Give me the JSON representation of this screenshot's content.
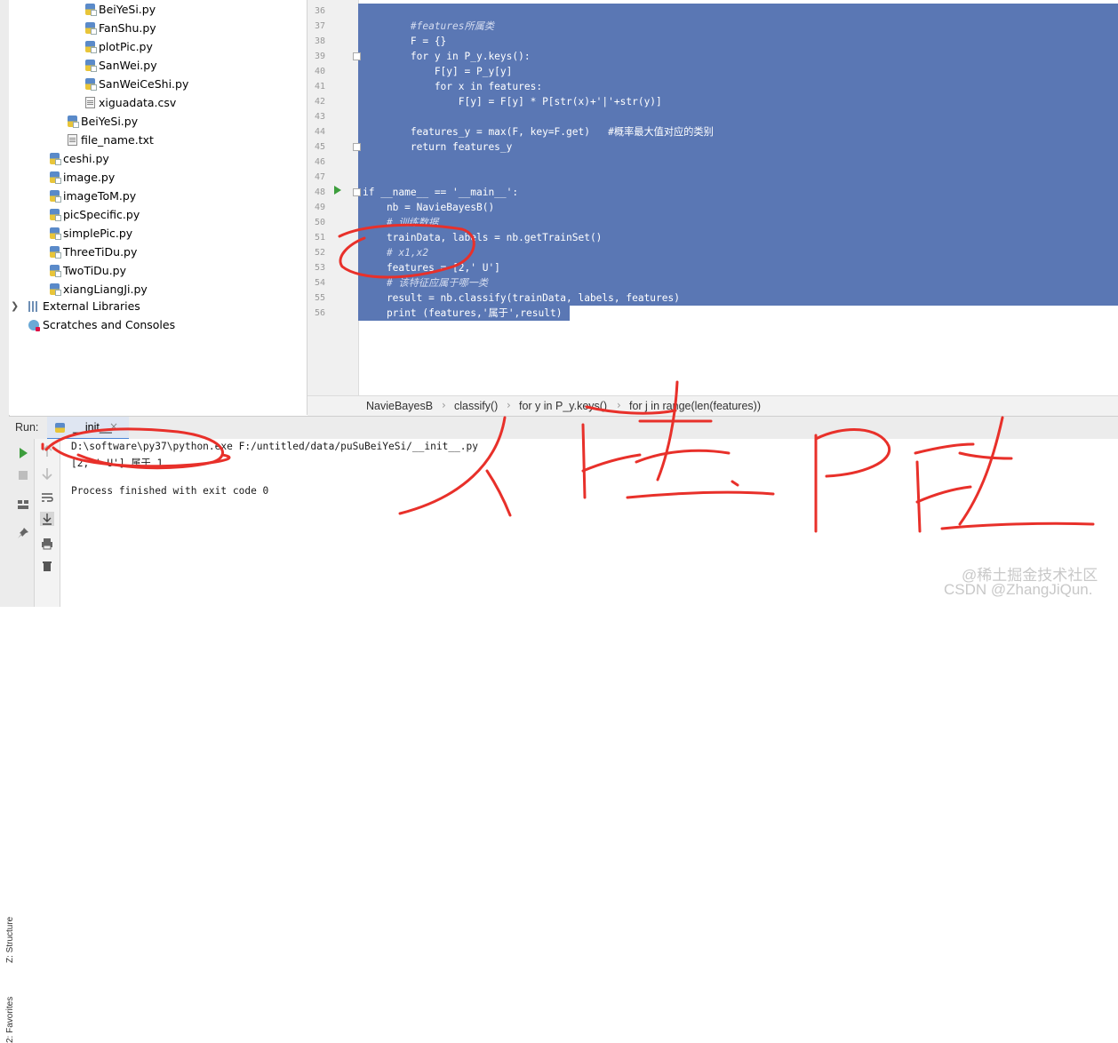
{
  "project_tree": {
    "items": [
      {
        "label": "BeiYeSi.py",
        "type": "py"
      },
      {
        "label": "FanShu.py",
        "type": "py"
      },
      {
        "label": "plotPic.py",
        "type": "py"
      },
      {
        "label": "SanWei.py",
        "type": "py"
      },
      {
        "label": "SanWeiCeShi.py",
        "type": "py"
      },
      {
        "label": "xiguadata.csv",
        "type": "txt"
      },
      {
        "label": "BeiYeSi.py",
        "type": "py"
      },
      {
        "label": "file_name.txt",
        "type": "txt"
      },
      {
        "label": "ceshi.py",
        "type": "py"
      },
      {
        "label": "image.py",
        "type": "py"
      },
      {
        "label": "imageToM.py",
        "type": "py"
      },
      {
        "label": "picSpecific.py",
        "type": "py"
      },
      {
        "label": "simplePic.py",
        "type": "py"
      },
      {
        "label": "ThreeTiDu.py",
        "type": "py"
      },
      {
        "label": "TwoTiDu.py",
        "type": "py"
      },
      {
        "label": "xiangLiangJi.py",
        "type": "py"
      }
    ],
    "external_libraries": "External Libraries",
    "scratches": "Scratches and Consoles"
  },
  "editor": {
    "lines": [
      {
        "n": "36",
        "text": ""
      },
      {
        "n": "37",
        "text": "        #features所属类",
        "comment": true
      },
      {
        "n": "38",
        "text": "        F = {}"
      },
      {
        "n": "39",
        "text": "        for y in P_y.keys():"
      },
      {
        "n": "40",
        "text": "            F[y] = P_y[y]"
      },
      {
        "n": "41",
        "text": "            for x in features:"
      },
      {
        "n": "42",
        "text": "                F[y] = F[y] * P[str(x)+'|'+str(y)]"
      },
      {
        "n": "43",
        "text": ""
      },
      {
        "n": "44",
        "text": "        features_y = max(F, key=F.get)   #概率最大值对应的类别"
      },
      {
        "n": "45",
        "text": "        return features_y"
      },
      {
        "n": "46",
        "text": ""
      },
      {
        "n": "47",
        "text": ""
      },
      {
        "n": "48",
        "text": "if __name__ == '__main__':"
      },
      {
        "n": "49",
        "text": "    nb = NavieBayesB()"
      },
      {
        "n": "50",
        "text": "    # 训练数据",
        "comment": true
      },
      {
        "n": "51",
        "text": "    trainData, labels = nb.getTrainSet()"
      },
      {
        "n": "52",
        "text": "    # x1,x2",
        "comment": true
      },
      {
        "n": "53",
        "text": "    features = [2,' U']"
      },
      {
        "n": "54",
        "text": "    # 该特征应属于哪一类",
        "comment": true
      },
      {
        "n": "55",
        "text": "    result = nb.classify(trainData, labels, features)"
      },
      {
        "n": "56",
        "text": "    print (features,'属于',result)"
      }
    ]
  },
  "breadcrumb": [
    "NavieBayesB",
    "classify()",
    "for y in P_y.keys()",
    "for j in range(len(features))"
  ],
  "run_panel": {
    "label": "Run:",
    "tab": "__init__",
    "close": "×",
    "console": [
      "D:\\software\\py37\\python.exe F:/untitled/data/puSuBeiYeSi/__init__.py",
      "[2, ' U'] 属于 1",
      "",
      "Process finished with exit code 0"
    ]
  },
  "side_tabs": {
    "structure": "Z: Structure",
    "favorites": "2: Favorites"
  },
  "watermark": "@稀土掘金技术社区\nCSDN @ZhangJiQun.",
  "colors": {
    "selection": "#5a77b4",
    "annotation": "#e8302a",
    "run_green": "#3d9e3d"
  }
}
